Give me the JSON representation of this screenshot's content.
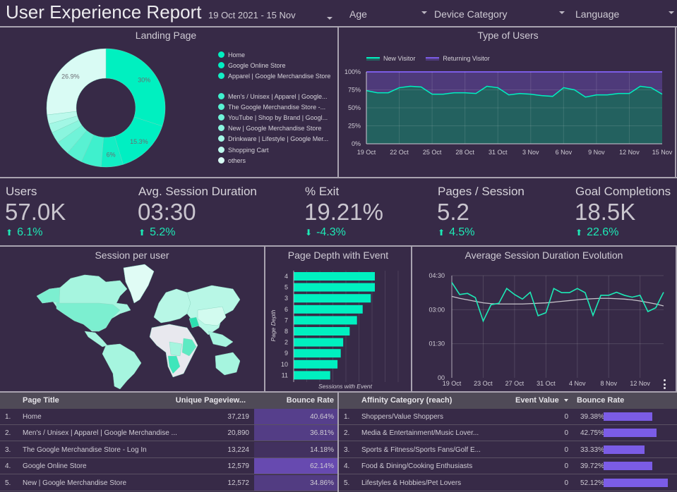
{
  "header": {
    "title": "User Experience Report",
    "filters": {
      "date_range": "19 Oct 2021 - 15 Nov",
      "age": "Age",
      "device_category": "Device Category",
      "language": "Language"
    }
  },
  "colors": {
    "background": "#372a47",
    "accent_green": "#00f0c0",
    "accent_purple": "#7b5ce6",
    "returning_fill": "#4e3a7a",
    "new_fill": "#23615f",
    "table_header": "#4f4a57"
  },
  "landing_page": {
    "title": "Landing Page",
    "legend": [
      {
        "label": "Home",
        "color": "#00f0c0"
      },
      {
        "label": "Google Online Store",
        "color": "#00efc2"
      },
      {
        "label": "Apparel | Google Merchandise Store",
        "color": "#12eec4"
      },
      {
        "label": "Men's / Unisex | Apparel | Google...",
        "color": "#3ff0cd"
      },
      {
        "label": "The Google Merchandise Store -...",
        "color": "#58f1d2"
      },
      {
        "label": "YouTube | Shop by Brand | Googl...",
        "color": "#70f3d8"
      },
      {
        "label": "New | Google Merchandise Store",
        "color": "#8af5de"
      },
      {
        "label": "Drinkware | Lifestyle | Google Mer...",
        "color": "#a2f7e5"
      },
      {
        "label": "Shopping Cart",
        "color": "#bcf9ec"
      },
      {
        "label": "others",
        "color": "#d9fbf4"
      }
    ],
    "slice_percent": [
      30,
      15.3,
      6,
      5.5,
      4.4,
      3.8,
      3.1,
      2.5,
      2.5,
      26.9
    ],
    "slice_labels": [
      "30%",
      "15.3%",
      "6%",
      "",
      "",
      "",
      "",
      "",
      "",
      "26.9%"
    ]
  },
  "type_of_users": {
    "title": "Type of Users",
    "legend": [
      "New Visitor",
      "Returning Visitor"
    ],
    "y_ticks": [
      "100%",
      "75%",
      "50%",
      "25%",
      "0%"
    ],
    "x_ticks": [
      "19 Oct",
      "22 Oct",
      "25 Oct",
      "28 Oct",
      "31 Oct",
      "3 Nov",
      "6 Nov",
      "9 Nov",
      "12 Nov",
      "15 Nov"
    ],
    "new_visitor_percent": [
      74,
      71,
      71,
      78,
      80,
      79,
      69,
      69,
      71,
      71,
      70,
      80,
      78,
      68,
      70,
      69,
      67,
      66,
      78,
      75,
      65,
      68,
      68,
      70,
      70,
      80,
      78,
      69
    ]
  },
  "scorecards": [
    {
      "label": "Users",
      "value": "57.0K",
      "delta": "6.1%",
      "direction": "up"
    },
    {
      "label": "Avg. Session Duration",
      "value": "03:30",
      "delta": "5.2%",
      "direction": "up"
    },
    {
      "label": "% Exit",
      "value": "19.21%",
      "delta": "-4.3%",
      "direction": "down"
    },
    {
      "label": "Pages / Session",
      "value": "5.2",
      "delta": "4.5%",
      "direction": "up"
    },
    {
      "label": "Goal Completions",
      "value": "18.5K",
      "delta": "22.6%",
      "direction": "up"
    }
  ],
  "session_map": {
    "title": "Session per user"
  },
  "page_depth": {
    "title": "Page Depth with Event",
    "y_axis_label": "Page Depth",
    "x_axis_label": "Sessions with Event",
    "categories": [
      "4",
      "5",
      "3",
      "6",
      "7",
      "8",
      "2",
      "9",
      "10",
      "11"
    ],
    "values": [
      100,
      100,
      95,
      85,
      78,
      69,
      61,
      58,
      54,
      45
    ]
  },
  "session_duration": {
    "title": "Average Session Duration Evolution",
    "y_ticks": [
      "04:30",
      "03:00",
      "01:30",
      "00"
    ],
    "x_ticks": [
      "19 Oct",
      "23 Oct",
      "27 Oct",
      "31 Oct",
      "4 Nov",
      "8 Nov",
      "12 Nov"
    ],
    "seconds": [
      252,
      220,
      223,
      212,
      150,
      193,
      197,
      236,
      220,
      208,
      226,
      164,
      172,
      236,
      225,
      225,
      236,
      225,
      165,
      218,
      218,
      226,
      218,
      213,
      218,
      175,
      185,
      226
    ],
    "trend_seconds": [
      215,
      210,
      206,
      202,
      198,
      196,
      195,
      195,
      195,
      195,
      196,
      197,
      198,
      200,
      202,
      204,
      206,
      208,
      209,
      210,
      210,
      209,
      208,
      206,
      203,
      199,
      195,
      190
    ]
  },
  "pages_table": {
    "columns": [
      "Page Title",
      "Unique Pageview...",
      "Bounce Rate"
    ],
    "rows": [
      {
        "rank": "1.",
        "title": "Home",
        "pageviews": "37,219",
        "bounce": "40.64%",
        "bounce_value": 40.64
      },
      {
        "rank": "2.",
        "title": "Men's / Unisex | Apparel | Google Merchandise ...",
        "pageviews": "20,890",
        "bounce": "36.81%",
        "bounce_value": 36.81
      },
      {
        "rank": "3.",
        "title": "The Google Merchandise Store - Log In",
        "pageviews": "13,224",
        "bounce": "14.18%",
        "bounce_value": 14.18
      },
      {
        "rank": "4.",
        "title": "Google Online Store",
        "pageviews": "12,579",
        "bounce": "62.14%",
        "bounce_value": 62.14
      },
      {
        "rank": "5.",
        "title": "New | Google Merchandise Store",
        "pageviews": "12,572",
        "bounce": "34.86%",
        "bounce_value": 34.86
      }
    ]
  },
  "affinity_table": {
    "columns": [
      "Affinity Category (reach)",
      "Event Value",
      "Bounce Rate"
    ],
    "sort_icon": "sort-desc",
    "rows": [
      {
        "rank": "1.",
        "category": "Shoppers/Value Shoppers",
        "event_value": "0",
        "bounce": "39.38%",
        "bounce_value": 39.38
      },
      {
        "rank": "2.",
        "category": "Media & Entertainment/Music Lover...",
        "event_value": "0",
        "bounce": "42.75%",
        "bounce_value": 42.75
      },
      {
        "rank": "3.",
        "category": "Sports & Fitness/Sports Fans/Golf E...",
        "event_value": "0",
        "bounce": "33.33%",
        "bounce_value": 33.33
      },
      {
        "rank": "4.",
        "category": "Food & Dining/Cooking Enthusiasts",
        "event_value": "0",
        "bounce": "39.72%",
        "bounce_value": 39.72
      },
      {
        "rank": "5.",
        "category": "Lifestyles & Hobbies/Pet Lovers",
        "event_value": "0",
        "bounce": "52.12%",
        "bounce_value": 52.12
      }
    ]
  }
}
